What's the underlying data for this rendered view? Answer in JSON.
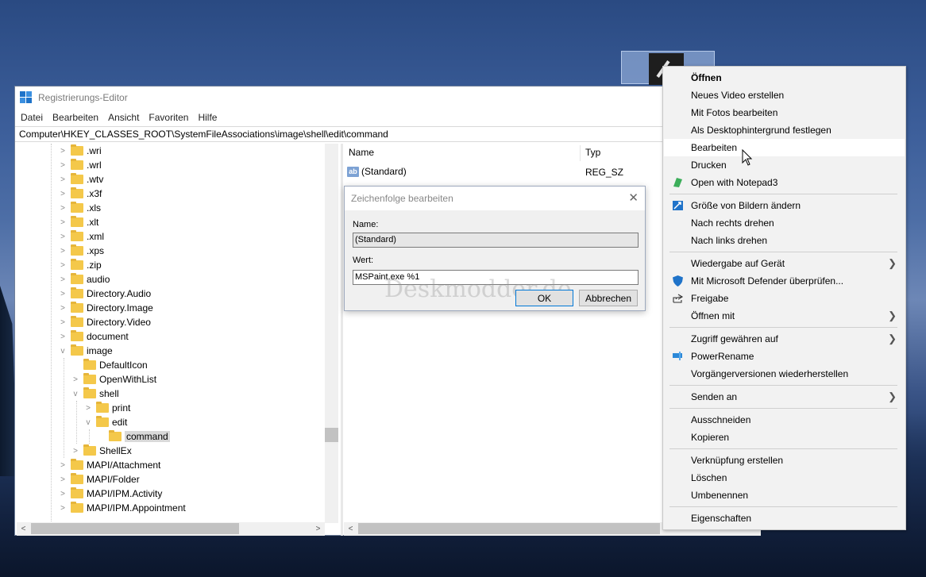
{
  "window": {
    "title": "Registrierungs-Editor",
    "menu": [
      "Datei",
      "Bearbeiten",
      "Ansicht",
      "Favoriten",
      "Hilfe"
    ],
    "address": "Computer\\HKEY_CLASSES_ROOT\\SystemFileAssociations\\image\\shell\\edit\\command"
  },
  "tree": [
    {
      "label": ".wri"
    },
    {
      "label": ".wrl"
    },
    {
      "label": ".wtv"
    },
    {
      "label": ".x3f"
    },
    {
      "label": ".xls"
    },
    {
      "label": ".xlt"
    },
    {
      "label": ".xml"
    },
    {
      "label": ".xps"
    },
    {
      "label": ".zip"
    },
    {
      "label": "audio"
    },
    {
      "label": "Directory.Audio"
    },
    {
      "label": "Directory.Image"
    },
    {
      "label": "Directory.Video"
    },
    {
      "label": "document"
    },
    {
      "label": "image"
    },
    {
      "label": "DefaultIcon"
    },
    {
      "label": "OpenWithList"
    },
    {
      "label": "shell"
    },
    {
      "label": "print"
    },
    {
      "label": "edit"
    },
    {
      "label": "command"
    },
    {
      "label": "ShellEx"
    },
    {
      "label": "MAPI/Attachment"
    },
    {
      "label": "MAPI/Folder"
    },
    {
      "label": "MAPI/IPM.Activity"
    },
    {
      "label": "MAPI/IPM.Appointment"
    }
  ],
  "list": {
    "col_name": "Name",
    "col_type": "Typ",
    "rows": [
      {
        "name": "(Standard)",
        "type": "REG_SZ",
        "icon": "ab"
      }
    ]
  },
  "dialog": {
    "title": "Zeichenfolge bearbeiten",
    "name_label": "Name:",
    "name_value": "(Standard)",
    "value_label": "Wert:",
    "value_value": "MSPaint.exe %1",
    "ok": "OK",
    "cancel": "Abbrechen",
    "watermark": "Deskmodder.de"
  },
  "context_menu": [
    {
      "label": "Öffnen",
      "bold": true
    },
    {
      "label": "Neues Video erstellen"
    },
    {
      "label": "Mit Fotos bearbeiten"
    },
    {
      "label": "Als Desktophintergrund festlegen"
    },
    {
      "label": "Bearbeiten",
      "highlighted": true
    },
    {
      "label": "Drucken"
    },
    {
      "label": "Open with Notepad3",
      "icon": "notepad3-icon"
    },
    {
      "label": "Größe von Bildern ändern",
      "icon": "image-resizer-icon"
    },
    {
      "label": "Nach rechts drehen"
    },
    {
      "label": "Nach links drehen"
    },
    {
      "label": "Wiedergabe auf Gerät",
      "submenu": true
    },
    {
      "label": "Mit Microsoft Defender überprüfen...",
      "icon": "defender-shield-icon"
    },
    {
      "label": "Freigabe",
      "icon": "share-icon"
    },
    {
      "label": "Öffnen mit",
      "submenu": true
    },
    {
      "label": "Zugriff gewähren auf",
      "submenu": true
    },
    {
      "label": "PowerRename",
      "icon": "powerrename-icon"
    },
    {
      "label": "Vorgängerversionen wiederherstellen"
    },
    {
      "label": "Senden an",
      "submenu": true
    },
    {
      "label": "Ausschneiden"
    },
    {
      "label": "Kopieren"
    },
    {
      "label": "Verknüpfung erstellen"
    },
    {
      "label": "Löschen"
    },
    {
      "label": "Umbenennen"
    },
    {
      "label": "Eigenschaften"
    }
  ],
  "colors": {
    "accent": "#1f73c9",
    "folder": "#f4c84a",
    "menu_bg": "#f2f2f2"
  }
}
